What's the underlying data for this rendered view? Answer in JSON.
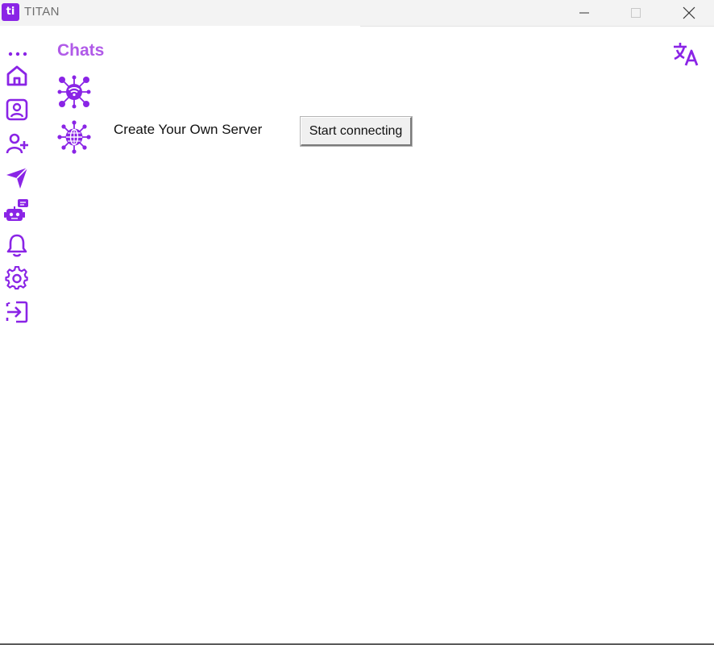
{
  "window": {
    "title": "TITAN",
    "logo_text": "ti",
    "accent": "#8a24e6"
  },
  "titlebar": {
    "minimize_icon": "minimize-icon",
    "maximize_icon": "maximize-icon",
    "close_icon": "close-icon"
  },
  "sidebar": {
    "items": [
      {
        "name": "more",
        "icon": "more-dots-icon"
      },
      {
        "name": "home",
        "icon": "home-icon"
      },
      {
        "name": "profile",
        "icon": "profile-card-icon"
      },
      {
        "name": "add-friend",
        "icon": "user-plus-icon"
      },
      {
        "name": "send",
        "icon": "send-icon"
      },
      {
        "name": "bot",
        "icon": "robot-chat-icon"
      },
      {
        "name": "notifications",
        "icon": "bell-icon"
      },
      {
        "name": "settings",
        "icon": "gear-icon"
      },
      {
        "name": "logout",
        "icon": "sign-in-arrow-icon"
      }
    ]
  },
  "main": {
    "title": "Chats",
    "translate_icon": "translate-icon",
    "servers": [
      {
        "icon": "wifi-network-icon"
      },
      {
        "icon": "globe-network-icon",
        "label": "Create Your Own Server",
        "button_label": "Start connecting"
      }
    ]
  }
}
